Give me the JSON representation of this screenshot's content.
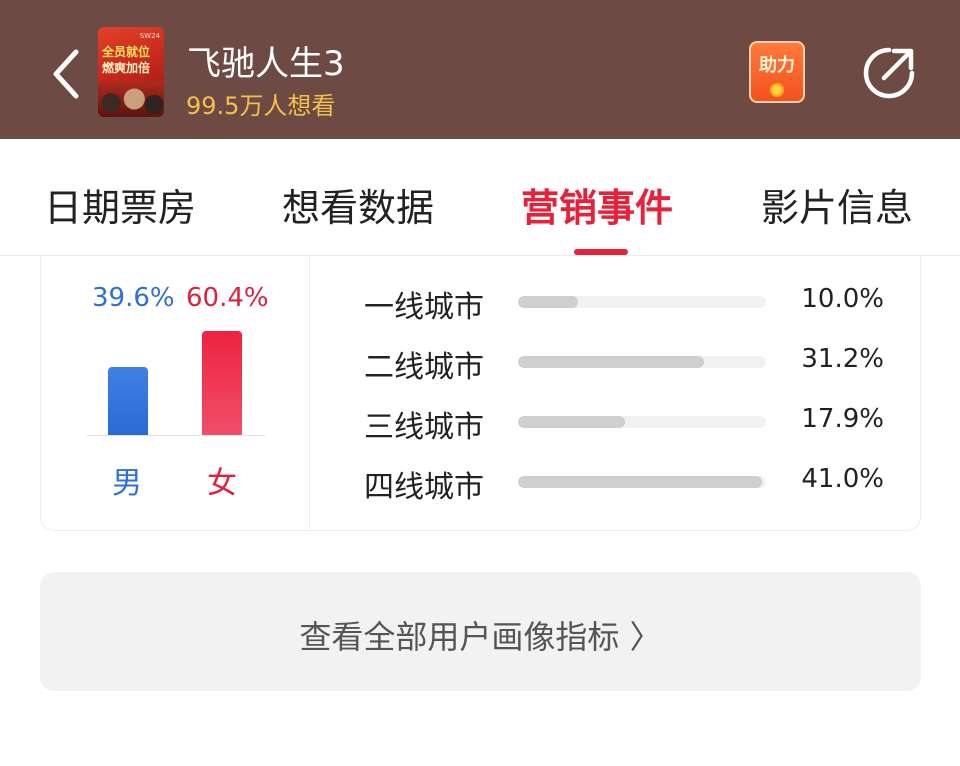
{
  "header": {
    "title": "飞驰人生3",
    "want_to_watch": "99.5万人想看",
    "poster_text_1": "全员就位",
    "poster_text_2": "燃爽加倍",
    "poster_text_3": "SW24",
    "boost_label": "助力"
  },
  "tabs": [
    {
      "label": "日期票房",
      "active": false
    },
    {
      "label": "想看数据",
      "active": false
    },
    {
      "label": "营销事件",
      "active": true
    },
    {
      "label": "影片信息",
      "active": false
    }
  ],
  "gender": {
    "male_label": "男",
    "female_label": "女",
    "male_pct_text": "39.6%",
    "female_pct_text": "60.4%",
    "male_value": 39.6,
    "female_value": 60.4
  },
  "cities": [
    {
      "name": "一线城市",
      "value_text": "10.0%",
      "value": 10.0
    },
    {
      "name": "二线城市",
      "value_text": "31.2%",
      "value": 31.2
    },
    {
      "name": "三线城市",
      "value_text": "17.9%",
      "value": 17.9
    },
    {
      "name": "四线城市",
      "value_text": "41.0%",
      "value": 41.0
    }
  ],
  "view_all_button": "查看全部用户画像指标 〉",
  "colors": {
    "header_bg": "#6e4a44",
    "accent_red": "#e8213a",
    "male_blue": "#2f6fd6",
    "subtitle_gold": "#f5c04a"
  }
}
